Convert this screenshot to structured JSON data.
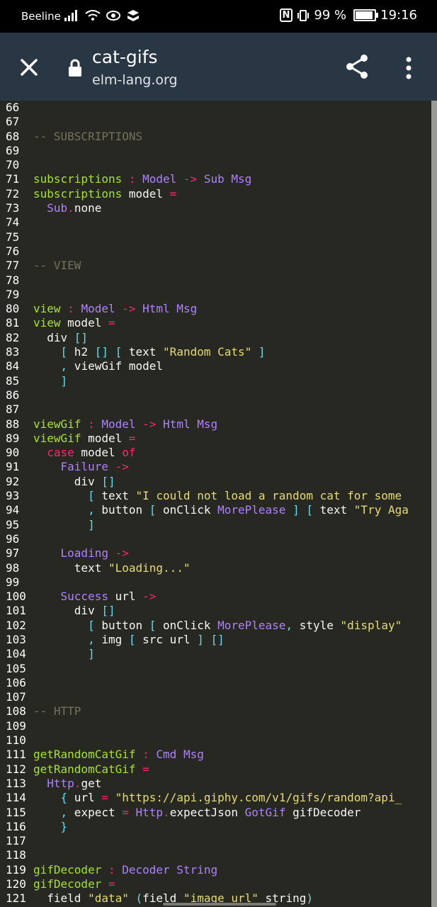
{
  "status_bar": {
    "carrier": "Beeline",
    "left_icons": "signal-icon wifi-icon eye-icon app-icon",
    "nfc": "N",
    "battery_percent": "99 %",
    "battery_level": 0.99,
    "time": "19:16"
  },
  "toolbar": {
    "title": "cat-gifs",
    "url": "elm-lang.org",
    "background_color": "#293643"
  },
  "code_lines": [
    {
      "n": "66",
      "tokens": []
    },
    {
      "n": "67",
      "tokens": []
    },
    {
      "n": "68",
      "tokens": [
        {
          "c": "comment",
          "t": "-- SUBSCRIPTIONS"
        }
      ]
    },
    {
      "n": "69",
      "tokens": []
    },
    {
      "n": "70",
      "tokens": []
    },
    {
      "n": "71",
      "tokens": [
        {
          "c": "def",
          "t": "subscriptions"
        },
        {
          "c": "op",
          "t": " : "
        },
        {
          "c": "type",
          "t": "Model"
        },
        {
          "c": "op",
          "t": " -> "
        },
        {
          "c": "type",
          "t": "Sub Msg"
        }
      ]
    },
    {
      "n": "72",
      "tokens": [
        {
          "c": "def",
          "t": "subscriptions"
        },
        {
          "c": "plain",
          "t": " model "
        },
        {
          "c": "op",
          "t": "="
        }
      ]
    },
    {
      "n": "73",
      "tokens": [
        {
          "c": "plain",
          "t": "  "
        },
        {
          "c": "type",
          "t": "Sub"
        },
        {
          "c": "op",
          "t": "."
        },
        {
          "c": "plain",
          "t": "none"
        }
      ]
    },
    {
      "n": "74",
      "tokens": []
    },
    {
      "n": "75",
      "tokens": []
    },
    {
      "n": "76",
      "tokens": []
    },
    {
      "n": "77",
      "tokens": [
        {
          "c": "comment",
          "t": "-- VIEW"
        }
      ]
    },
    {
      "n": "78",
      "tokens": []
    },
    {
      "n": "79",
      "tokens": []
    },
    {
      "n": "80",
      "tokens": [
        {
          "c": "def",
          "t": "view"
        },
        {
          "c": "op",
          "t": " : "
        },
        {
          "c": "type",
          "t": "Model"
        },
        {
          "c": "op",
          "t": " -> "
        },
        {
          "c": "type",
          "t": "Html Msg"
        }
      ]
    },
    {
      "n": "81",
      "tokens": [
        {
          "c": "def",
          "t": "view"
        },
        {
          "c": "plain",
          "t": " model "
        },
        {
          "c": "op",
          "t": "="
        }
      ]
    },
    {
      "n": "82",
      "tokens": [
        {
          "c": "plain",
          "t": "  div "
        },
        {
          "c": "brk",
          "t": "[]"
        }
      ]
    },
    {
      "n": "83",
      "tokens": [
        {
          "c": "plain",
          "t": "    "
        },
        {
          "c": "brk",
          "t": "["
        },
        {
          "c": "plain",
          "t": " h2 "
        },
        {
          "c": "brk",
          "t": "[]"
        },
        {
          "c": "plain",
          "t": " "
        },
        {
          "c": "brk",
          "t": "["
        },
        {
          "c": "plain",
          "t": " text "
        },
        {
          "c": "str",
          "t": "\"Random Cats\""
        },
        {
          "c": "plain",
          "t": " "
        },
        {
          "c": "brk",
          "t": "]"
        }
      ]
    },
    {
      "n": "84",
      "tokens": [
        {
          "c": "plain",
          "t": "    "
        },
        {
          "c": "brk",
          "t": ","
        },
        {
          "c": "plain",
          "t": " viewGif model"
        }
      ]
    },
    {
      "n": "85",
      "tokens": [
        {
          "c": "plain",
          "t": "    "
        },
        {
          "c": "brk",
          "t": "]"
        }
      ]
    },
    {
      "n": "86",
      "tokens": []
    },
    {
      "n": "87",
      "tokens": []
    },
    {
      "n": "88",
      "tokens": [
        {
          "c": "def",
          "t": "viewGif"
        },
        {
          "c": "op",
          "t": " : "
        },
        {
          "c": "type",
          "t": "Model"
        },
        {
          "c": "op",
          "t": " -> "
        },
        {
          "c": "type",
          "t": "Html Msg"
        }
      ]
    },
    {
      "n": "89",
      "tokens": [
        {
          "c": "def",
          "t": "viewGif"
        },
        {
          "c": "plain",
          "t": " model "
        },
        {
          "c": "op",
          "t": "="
        }
      ]
    },
    {
      "n": "90",
      "tokens": [
        {
          "c": "plain",
          "t": "  "
        },
        {
          "c": "op",
          "t": "case"
        },
        {
          "c": "plain",
          "t": " model "
        },
        {
          "c": "op",
          "t": "of"
        }
      ]
    },
    {
      "n": "91",
      "tokens": [
        {
          "c": "plain",
          "t": "    "
        },
        {
          "c": "type",
          "t": "Failure"
        },
        {
          "c": "op",
          "t": " ->"
        }
      ]
    },
    {
      "n": "92",
      "tokens": [
        {
          "c": "plain",
          "t": "      div "
        },
        {
          "c": "brk",
          "t": "[]"
        }
      ]
    },
    {
      "n": "93",
      "tokens": [
        {
          "c": "plain",
          "t": "        "
        },
        {
          "c": "brk",
          "t": "["
        },
        {
          "c": "plain",
          "t": " text "
        },
        {
          "c": "str",
          "t": "\"I could not load a random cat for some"
        }
      ]
    },
    {
      "n": "94",
      "tokens": [
        {
          "c": "plain",
          "t": "        "
        },
        {
          "c": "brk",
          "t": ","
        },
        {
          "c": "plain",
          "t": " button "
        },
        {
          "c": "brk",
          "t": "["
        },
        {
          "c": "plain",
          "t": " onClick "
        },
        {
          "c": "type",
          "t": "MorePlease"
        },
        {
          "c": "plain",
          "t": " "
        },
        {
          "c": "brk",
          "t": "]"
        },
        {
          "c": "plain",
          "t": " "
        },
        {
          "c": "brk",
          "t": "["
        },
        {
          "c": "plain",
          "t": " text "
        },
        {
          "c": "str",
          "t": "\"Try Aga"
        }
      ]
    },
    {
      "n": "95",
      "tokens": [
        {
          "c": "plain",
          "t": "        "
        },
        {
          "c": "brk",
          "t": "]"
        }
      ]
    },
    {
      "n": "96",
      "tokens": []
    },
    {
      "n": "97",
      "tokens": [
        {
          "c": "plain",
          "t": "    "
        },
        {
          "c": "type",
          "t": "Loading"
        },
        {
          "c": "op",
          "t": " ->"
        }
      ]
    },
    {
      "n": "98",
      "tokens": [
        {
          "c": "plain",
          "t": "      text "
        },
        {
          "c": "str",
          "t": "\"Loading...\""
        }
      ]
    },
    {
      "n": "99",
      "tokens": []
    },
    {
      "n": "100",
      "tokens": [
        {
          "c": "plain",
          "t": "    "
        },
        {
          "c": "type",
          "t": "Success"
        },
        {
          "c": "plain",
          "t": " url "
        },
        {
          "c": "op",
          "t": "->"
        }
      ]
    },
    {
      "n": "101",
      "tokens": [
        {
          "c": "plain",
          "t": "      div "
        },
        {
          "c": "brk",
          "t": "[]"
        }
      ]
    },
    {
      "n": "102",
      "tokens": [
        {
          "c": "plain",
          "t": "        "
        },
        {
          "c": "brk",
          "t": "["
        },
        {
          "c": "plain",
          "t": " button "
        },
        {
          "c": "brk",
          "t": "["
        },
        {
          "c": "plain",
          "t": " onClick "
        },
        {
          "c": "type",
          "t": "MorePlease"
        },
        {
          "c": "brk",
          "t": ","
        },
        {
          "c": "plain",
          "t": " style "
        },
        {
          "c": "str",
          "t": "\"display\""
        }
      ]
    },
    {
      "n": "103",
      "tokens": [
        {
          "c": "plain",
          "t": "        "
        },
        {
          "c": "brk",
          "t": ","
        },
        {
          "c": "plain",
          "t": " img "
        },
        {
          "c": "brk",
          "t": "["
        },
        {
          "c": "plain",
          "t": " src url "
        },
        {
          "c": "brk",
          "t": "]"
        },
        {
          "c": "plain",
          "t": " "
        },
        {
          "c": "brk",
          "t": "[]"
        }
      ]
    },
    {
      "n": "104",
      "tokens": [
        {
          "c": "plain",
          "t": "        "
        },
        {
          "c": "brk",
          "t": "]"
        }
      ]
    },
    {
      "n": "105",
      "tokens": []
    },
    {
      "n": "106",
      "tokens": []
    },
    {
      "n": "107",
      "tokens": []
    },
    {
      "n": "108",
      "tokens": [
        {
          "c": "comment",
          "t": "-- HTTP"
        }
      ]
    },
    {
      "n": "109",
      "tokens": []
    },
    {
      "n": "110",
      "tokens": []
    },
    {
      "n": "111",
      "tokens": [
        {
          "c": "def",
          "t": "getRandomCatGif"
        },
        {
          "c": "op",
          "t": " : "
        },
        {
          "c": "type",
          "t": "Cmd Msg"
        }
      ]
    },
    {
      "n": "112",
      "tokens": [
        {
          "c": "def",
          "t": "getRandomCatGif"
        },
        {
          "c": "plain",
          "t": " "
        },
        {
          "c": "op",
          "t": "="
        }
      ]
    },
    {
      "n": "113",
      "tokens": [
        {
          "c": "plain",
          "t": "  "
        },
        {
          "c": "type",
          "t": "Http"
        },
        {
          "c": "op",
          "t": "."
        },
        {
          "c": "plain",
          "t": "get"
        }
      ]
    },
    {
      "n": "114",
      "tokens": [
        {
          "c": "plain",
          "t": "    "
        },
        {
          "c": "brk",
          "t": "{"
        },
        {
          "c": "plain",
          "t": " url "
        },
        {
          "c": "op",
          "t": "="
        },
        {
          "c": "plain",
          "t": " "
        },
        {
          "c": "str",
          "t": "\"https://api.giphy.com/v1/gifs/random?api_"
        }
      ]
    },
    {
      "n": "115",
      "tokens": [
        {
          "c": "plain",
          "t": "    "
        },
        {
          "c": "brk",
          "t": ","
        },
        {
          "c": "plain",
          "t": " expect "
        },
        {
          "c": "op",
          "t": "="
        },
        {
          "c": "plain",
          "t": " "
        },
        {
          "c": "type",
          "t": "Http"
        },
        {
          "c": "op",
          "t": "."
        },
        {
          "c": "plain",
          "t": "expectJson "
        },
        {
          "c": "type",
          "t": "GotGif"
        },
        {
          "c": "plain",
          "t": " gifDecoder"
        }
      ]
    },
    {
      "n": "116",
      "tokens": [
        {
          "c": "plain",
          "t": "    "
        },
        {
          "c": "brk",
          "t": "}"
        }
      ]
    },
    {
      "n": "117",
      "tokens": []
    },
    {
      "n": "118",
      "tokens": []
    },
    {
      "n": "119",
      "tokens": [
        {
          "c": "def",
          "t": "gifDecoder"
        },
        {
          "c": "op",
          "t": " : "
        },
        {
          "c": "type",
          "t": "Decoder String"
        }
      ]
    },
    {
      "n": "120",
      "tokens": [
        {
          "c": "def",
          "t": "gifDecoder"
        },
        {
          "c": "plain",
          "t": " "
        },
        {
          "c": "op",
          "t": "="
        }
      ]
    },
    {
      "n": "121",
      "tokens": [
        {
          "c": "plain",
          "t": "  field "
        },
        {
          "c": "str",
          "t": "\"data\""
        },
        {
          "c": "plain",
          "t": " "
        },
        {
          "c": "brk",
          "t": "("
        },
        {
          "c": "plain",
          "t": "field "
        },
        {
          "c": "str",
          "t": "\"image_url\""
        },
        {
          "c": "plain",
          "t": " string"
        },
        {
          "c": "brk",
          "t": ")"
        }
      ]
    }
  ],
  "colors": {
    "editor_bg": "#272822",
    "comment": "#75715e",
    "definition": "#a6e22e",
    "type": "#ae81ff",
    "operator": "#f92672",
    "string": "#e6db74",
    "bracket": "#66d9ef"
  }
}
